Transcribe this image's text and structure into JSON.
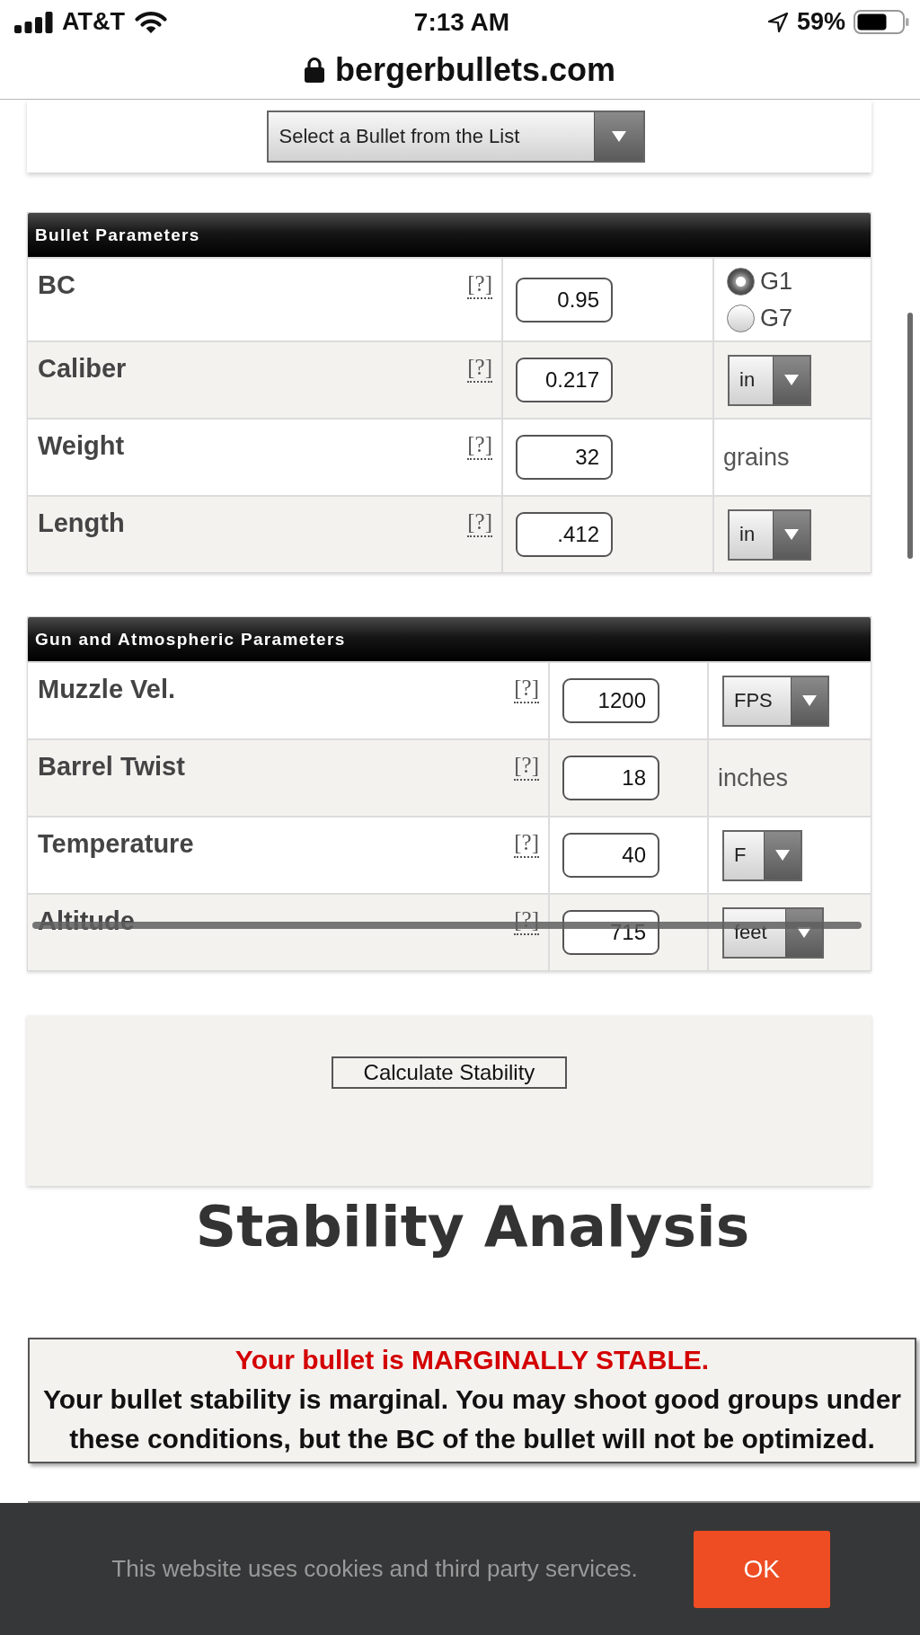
{
  "status_bar": {
    "carrier": "AT&T",
    "time": "7:13 AM",
    "battery": "59%"
  },
  "address_bar": {
    "url": "bergerbullets.com"
  },
  "bullet_select": {
    "value": "Select a Bullet from the List"
  },
  "bullet_parameters": {
    "title": "Bullet Parameters",
    "rows": [
      {
        "label": "BC",
        "help": "[?]",
        "value": "0.95",
        "unit": {
          "kind": "radio",
          "options": [
            {
              "label": "G1",
              "selected": true
            },
            {
              "label": "G7",
              "selected": false
            }
          ]
        }
      },
      {
        "label": "Caliber",
        "help": "[?]",
        "value": "0.217",
        "unit": {
          "kind": "dropdown",
          "value": "in"
        }
      },
      {
        "label": "Weight",
        "help": "[?]",
        "value": "32",
        "unit": {
          "kind": "text",
          "text": "grains"
        }
      },
      {
        "label": "Length",
        "help": "[?]",
        "value": ".412",
        "unit": {
          "kind": "dropdown",
          "value": "in"
        }
      }
    ]
  },
  "gun_parameters": {
    "title": "Gun and Atmospheric Parameters",
    "rows": [
      {
        "label": "Muzzle Vel.",
        "help": "[?]",
        "value": "1200",
        "unit": {
          "kind": "dropdown",
          "value": "FPS"
        }
      },
      {
        "label": "Barrel Twist",
        "help": "[?]",
        "value": "18",
        "unit": {
          "kind": "text",
          "text": "inches"
        }
      },
      {
        "label": "Temperature",
        "help": "[?]",
        "value": "40",
        "unit": {
          "kind": "dropdown",
          "value": "F"
        }
      },
      {
        "label": "Altitude",
        "help": "[?]",
        "value": "715",
        "unit": {
          "kind": "dropdown",
          "value": "feet"
        }
      }
    ]
  },
  "calculate_button": "Calculate Stability",
  "analysis": {
    "title": "Stability Analysis",
    "verdict": "Your bullet is MARGINALLY STABLE.",
    "message": "Your bullet stability is marginal. You may shoot good groups under these conditions, but the BC of the bullet will not be optimized."
  },
  "cookie_banner": {
    "text": "This website uses cookies and third party services.",
    "button": "OK"
  }
}
